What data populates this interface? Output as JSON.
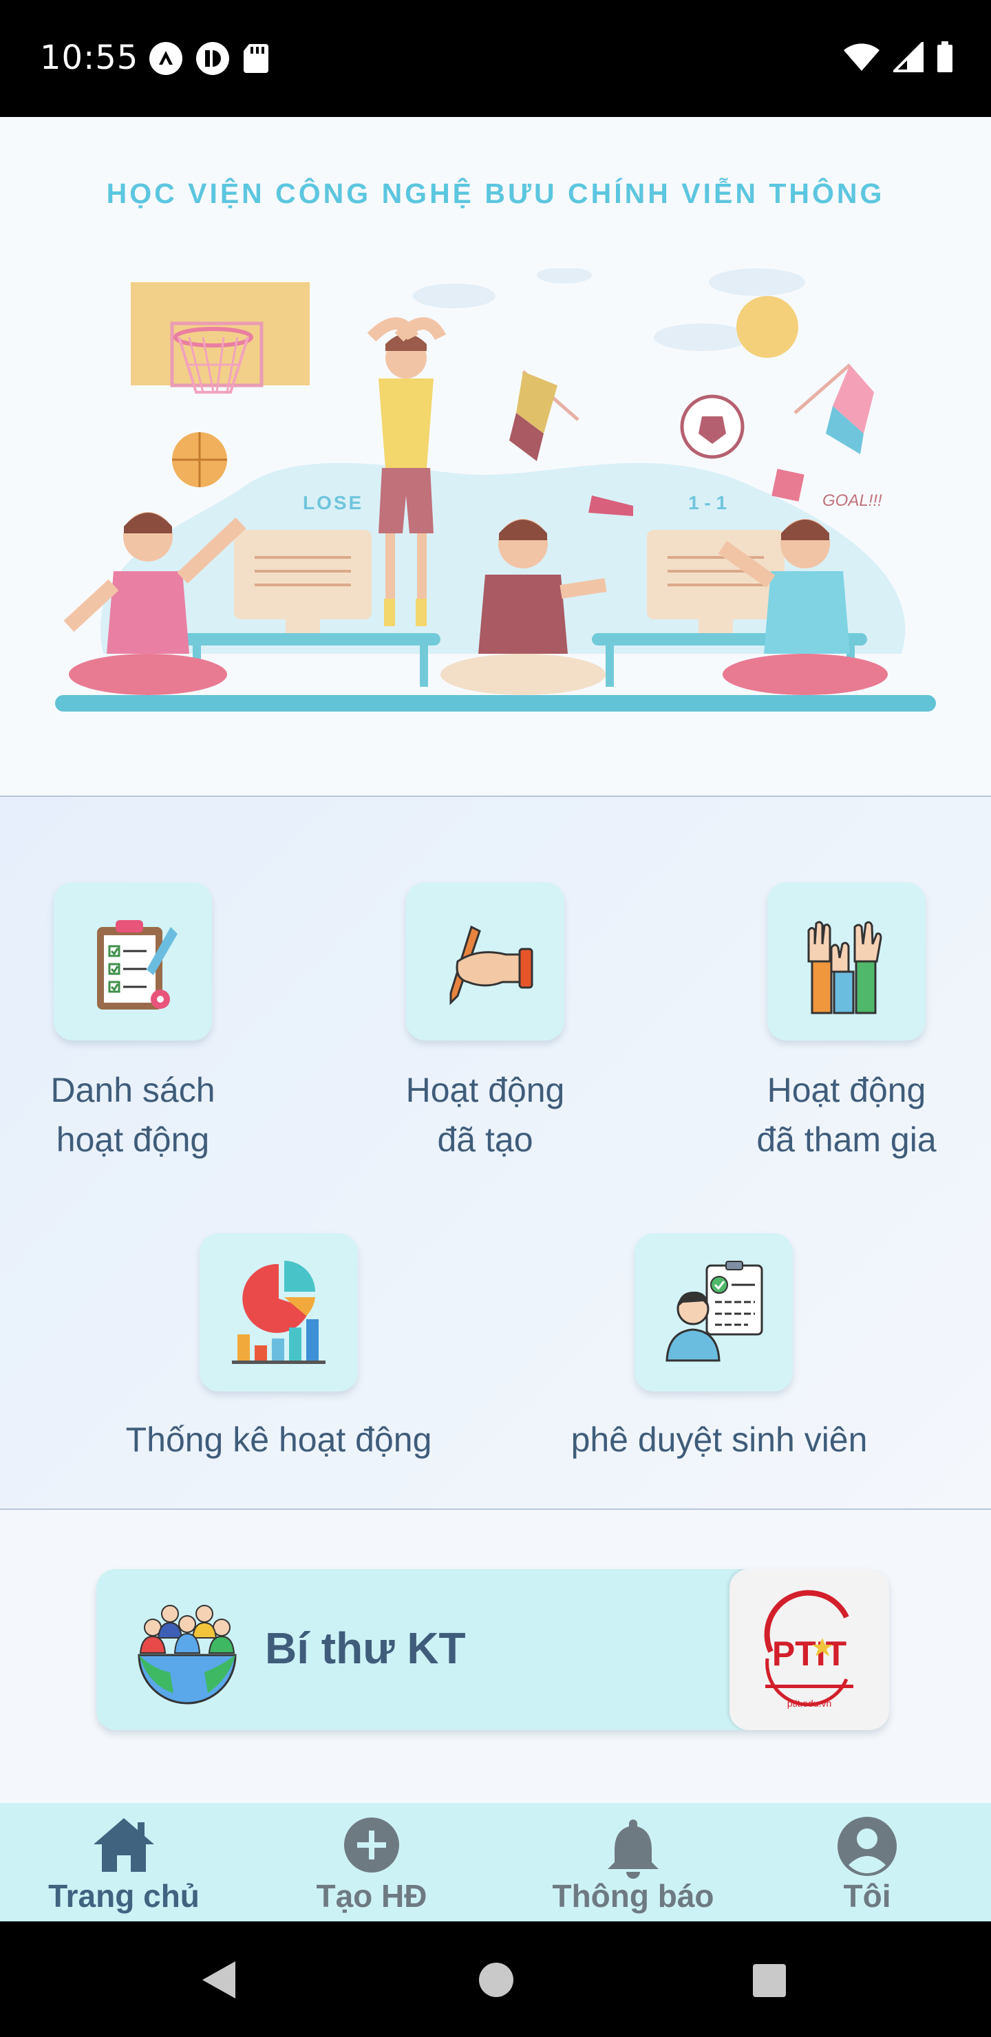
{
  "status_bar": {
    "time": "10:55"
  },
  "banner": {
    "title": "HỌC VIỆN CÔNG NGHỆ BƯU CHÍNH VIỄN THÔNG",
    "lose_text": "LOSE",
    "score_text": "1 - 1",
    "goal_text": "GOAL!!!"
  },
  "menu": {
    "items": [
      {
        "line1": "Danh sách",
        "line2": "hoạt động",
        "icon": "checklist-icon"
      },
      {
        "line1": "Hoạt động",
        "line2": "đã tạo",
        "icon": "writing-hand-icon"
      },
      {
        "line1": "Hoạt động",
        "line2": "đã tham gia",
        "icon": "raised-hands-icon"
      },
      {
        "line1": "Thống kê hoạt động",
        "icon": "statistics-chart-icon"
      },
      {
        "line1": "phê duyệt sinh viên",
        "icon": "student-approval-icon"
      }
    ]
  },
  "card": {
    "title": "Bí thư KT",
    "logo_text": "PTIT",
    "logo_url_text": "ptit.edu.vn"
  },
  "bottom_nav": {
    "items": [
      {
        "label": "Trang chủ",
        "icon": "home-icon",
        "active": true
      },
      {
        "label": "Tạo HĐ",
        "icon": "add-circle-icon",
        "active": false
      },
      {
        "label": "Thông báo",
        "icon": "bell-icon",
        "active": false
      },
      {
        "label": "Tôi",
        "icon": "account-icon",
        "active": false
      }
    ]
  },
  "colors": {
    "accent": "#40647f",
    "tile_bg": "#d3f3f7",
    "banner_title": "#5cc6df",
    "nav_bg": "#cdf2f6"
  }
}
